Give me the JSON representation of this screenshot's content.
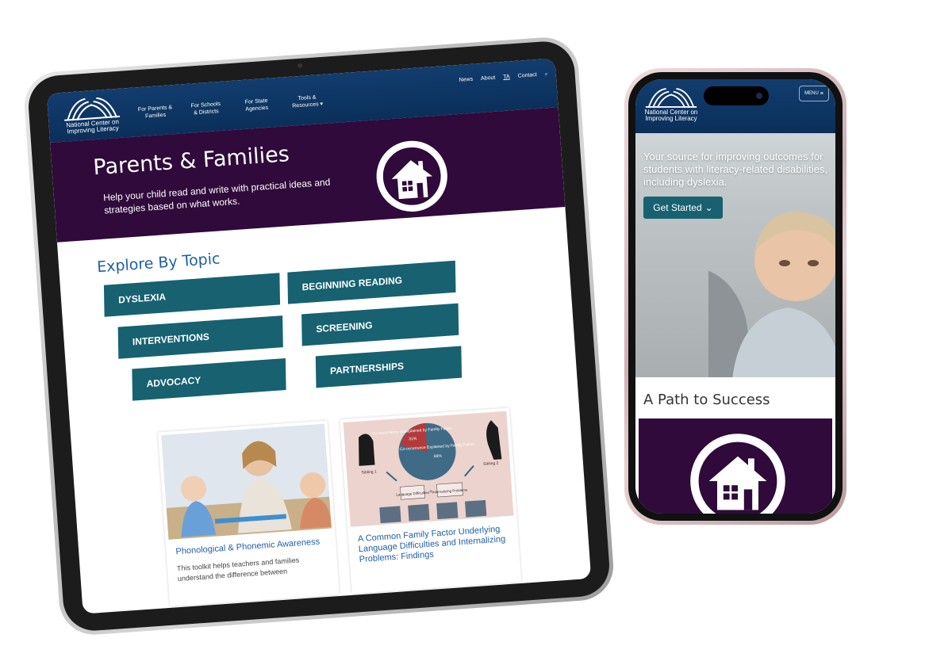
{
  "tablet": {
    "nav": {
      "logo_line1": "National Center on",
      "logo_line2": "Improving Literacy",
      "menu": [
        {
          "line1": "For Parents &",
          "line2": "Families"
        },
        {
          "line1": "For Schools",
          "line2": "& Districts"
        },
        {
          "line1": "For State",
          "line2": "Agencies"
        },
        {
          "line1": "Tools &",
          "line2": "Resources ▾"
        }
      ],
      "utility": {
        "news": "News",
        "about": "About",
        "ta": "TA",
        "contact": "Contact",
        "search_icon": "⌕"
      }
    },
    "hero": {
      "title": "Parents & Families",
      "subtitle": "Help your child read and write with practical ideas and strategies based on what works.",
      "icon": "house-icon"
    },
    "explore": {
      "heading": "Explore By Topic",
      "topics": [
        "DYSLEXIA",
        "BEGINNING READING",
        "INTERVENTIONS",
        "SCREENING",
        "ADVOCACY",
        "PARTNERSHIPS"
      ]
    },
    "cards": [
      {
        "title": "Phonological & Phonemic Awareness",
        "text": "This toolkit helps teachers and families understand the difference between"
      },
      {
        "title": "A Common Family Factor Underlying Language Difficulties and Internalizing Problems: Findings",
        "text": "",
        "infographic": {
          "slice1": "Co-occurrence Unexplained by Family Factor",
          "slice1_pct": "31%",
          "slice2": "Co-occurrence Explained by Family Factor",
          "slice2_pct": "69%",
          "sibling1": "Sibling 1",
          "sibling2": "Sibling 2",
          "box1": "Language Difficulties",
          "box2": "Internalizing Problems",
          "plus": "+"
        }
      }
    ]
  },
  "phone": {
    "nav": {
      "logo_line1": "National Center on",
      "logo_line2": "Improving Literacy",
      "menu_label": "MENU",
      "menu_icon": "≡"
    },
    "hero": {
      "text": "Your source for improving outcomes for students with literacy-related disabilities, including dyslexia.",
      "button": "Get Started",
      "button_icon": "⌄"
    },
    "path_heading": "A Path to Success",
    "colors": {
      "navy": "#0b2f5a",
      "purple": "#300a3a",
      "teal": "#176170",
      "link": "#1f5fa8"
    }
  }
}
